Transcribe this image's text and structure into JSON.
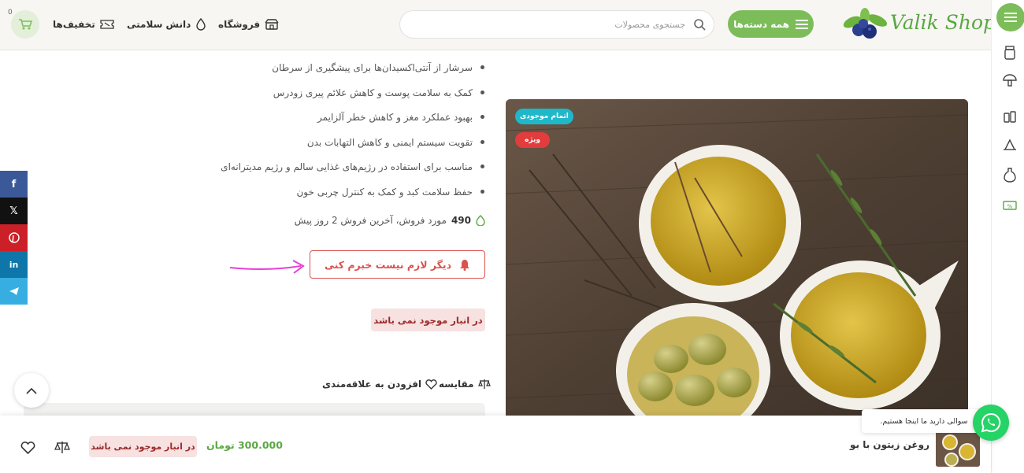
{
  "header": {
    "logo_text": "Valik Shop",
    "all_categories_label": "همه دسته‌ها",
    "search_placeholder": "جستجوی محصولات",
    "nav": {
      "shop": "فروشگاه",
      "health": "دانش سلامتی",
      "discounts": "تخفیف‌ها"
    },
    "cart_count": "0"
  },
  "product": {
    "badges": {
      "out_of_stock": "اتمام موجودی",
      "special": "ویژه"
    },
    "features": [
      "سرشار از آنتی‌اکسیدان‌ها برای پیشگیری از سرطان",
      "کمک به سلامت پوست و کاهش علائم پیری زودرس",
      "بهبود عملکرد مغز و کاهش خطر آلزایمر",
      "تقویت سیستم ایمنی و کاهش التهابات بدن",
      "مناسب برای استفاده در رژیم‌های غذایی سالم و رژیم مدیترانه‌ای",
      "حفظ سلامت کبد و کمک به کنترل چربی خون"
    ],
    "sold_count": "490",
    "sold_text": "مورد فروش، آخرین فروش 2 روز پیش",
    "notify_label": "دیگر لازم نیست خبرم کنی",
    "stock_status": "در انبار موجود نمی باشد",
    "compare_label": "مقایسه",
    "wishlist_label": "افزودن به علاقه‌مندی"
  },
  "sticky_bar": {
    "product_name": "روغن زیتون با بو",
    "price": "300.000 تومان",
    "stock_status": "در انبار موجود نمی باشد"
  },
  "chat": {
    "bubble_text": "سوالی دارید ما اینجا هستیم."
  },
  "social": [
    "facebook-icon",
    "x-icon",
    "pinterest-icon",
    "linkedin-icon",
    "telegram-icon"
  ],
  "colors": {
    "brand_green": "#7cbd5a",
    "alert_red": "#d9534f",
    "badge_cyan": "#1fb8c9",
    "badge_red": "#e23c3c",
    "arrow_magenta": "#e83fd6",
    "whatsapp": "#25d366"
  }
}
